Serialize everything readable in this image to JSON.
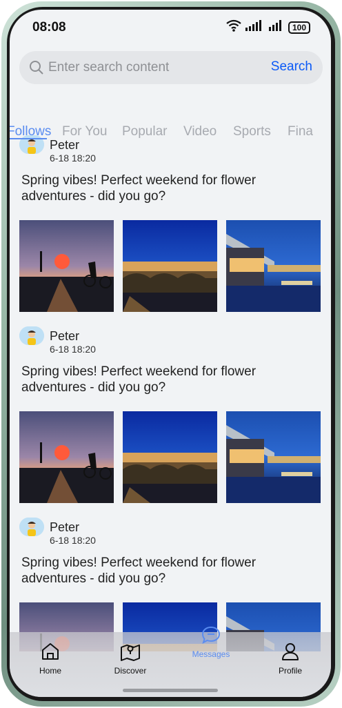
{
  "status_bar": {
    "time": "08:08",
    "battery": "100"
  },
  "search": {
    "placeholder": "Enter search content",
    "button_label": "Search"
  },
  "tabs": [
    {
      "label": "Follows",
      "active": true
    },
    {
      "label": "For You",
      "active": false
    },
    {
      "label": "Popular",
      "active": false
    },
    {
      "label": "Video",
      "active": false
    },
    {
      "label": "Sports",
      "active": false
    },
    {
      "label": "Fina",
      "active": false
    }
  ],
  "posts": [
    {
      "author": "Peter",
      "time": "6-18 18:20",
      "text_line1": "Spring vibes! Perfect weekend for flower",
      "text_line2": "adventures - did you go?",
      "photos": [
        "sunset-cyclist-photo",
        "bridge-night-photo",
        "riverside-building-photo"
      ]
    },
    {
      "author": "Peter",
      "time": "6-18 18:20",
      "text_line1": "Spring vibes! Perfect weekend for flower",
      "text_line2": "adventures - did you go?",
      "photos": [
        "sunset-cyclist-photo",
        "bridge-night-photo",
        "riverside-building-photo"
      ]
    },
    {
      "author": "Peter",
      "time": "6-18 18:20",
      "text_line1": "Spring vibes! Perfect weekend for flower",
      "text_line2": "adventures - did you go?",
      "photos": [
        "sunset-cyclist-photo",
        "bridge-night-photo",
        "riverside-building-photo"
      ]
    }
  ],
  "nav": {
    "home": "Home",
    "discover": "Discover",
    "messages": "Messages",
    "profile": "Profile"
  },
  "colors": {
    "accent": "#0a59f7",
    "active_tab": "#5a8cf0",
    "background": "#f1f3f5"
  }
}
